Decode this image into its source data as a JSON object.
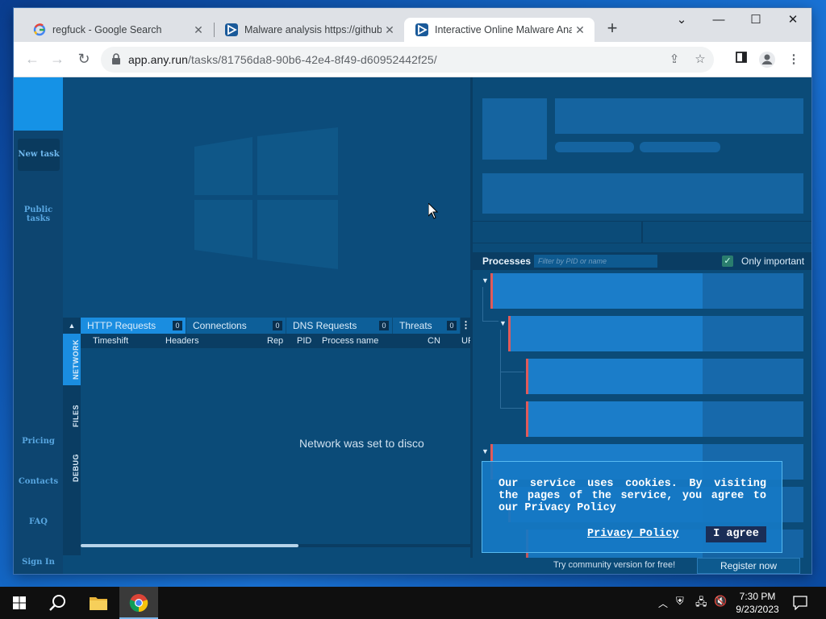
{
  "browser": {
    "tabs": [
      {
        "title": "regfuck - Google Search",
        "favicon": "google-icon",
        "active": false
      },
      {
        "title": "Malware analysis https://github.com",
        "favicon": "anyrun-icon",
        "active": false
      },
      {
        "title": "Interactive Online Malware Analysis",
        "favicon": "anyrun-icon",
        "active": true
      }
    ],
    "new_tab": "+",
    "window_controls": {
      "dropdown": "⌄",
      "minimize": "—",
      "maximize": "☐",
      "close": "✕"
    },
    "url_host": "app.any.run",
    "url_path": "/tasks/81756da8-90b6-42e4-8f49-d60952442f25/"
  },
  "sidebar": {
    "new_task": "New task",
    "public_tasks": "Public tasks",
    "pricing": "Pricing",
    "contacts": "Contacts",
    "faq": "FAQ",
    "sign_in": "Sign In"
  },
  "network_panel": {
    "tabs": [
      {
        "label": "HTTP Requests",
        "count": "0",
        "active": true
      },
      {
        "label": "Connections",
        "count": "0",
        "active": false
      },
      {
        "label": "DNS Requests",
        "count": "0",
        "active": false
      },
      {
        "label": "Threats",
        "count": "0",
        "active": false
      }
    ],
    "side_tabs": [
      "NETWORK",
      "FILES",
      "DEBUG"
    ],
    "columns": [
      "Timeshift",
      "Headers",
      "Rep",
      "PID",
      "Process name",
      "CN",
      "UR"
    ],
    "message": "Network was set to disco"
  },
  "processes": {
    "title": "Processes",
    "filter_placeholder": "Filter by PID or name",
    "only_important": "Only important",
    "only_important_checked": true
  },
  "cookie": {
    "text": "Our service uses cookies. By visiting the pages of the service, you agree to our Privacy Policy",
    "privacy_link": "Privacy Policy",
    "agree_button": "I agree"
  },
  "footer": {
    "try_text": "Try community version for free!",
    "register": "Register now"
  },
  "taskbar": {
    "time": "7:30 PM",
    "date": "9/23/2023"
  },
  "colors": {
    "accent": "#1a8de0",
    "panel": "#0b4b78",
    "sidebar": "#0d4570"
  }
}
